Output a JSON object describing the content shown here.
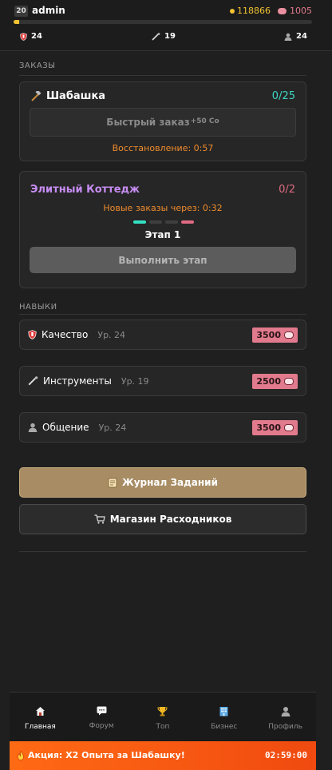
{
  "header": {
    "level": "20",
    "username": "admin",
    "coins": "118866",
    "brains": "1005",
    "xp_progress": 0.02,
    "stats": {
      "quality": "24",
      "tools": "19",
      "social": "24"
    }
  },
  "orders": {
    "section_label": "ЗАКАЗЫ",
    "basic": {
      "title": "Шабашка",
      "count": "0/25",
      "quick_label": "Быстрый заказ",
      "quick_cost": "+50 Co",
      "recovery": "Восстановление: 0:57"
    },
    "elite": {
      "title": "Элитный Коттедж",
      "count": "0/2",
      "timer": "Новые заказы через: 0:32",
      "stage": "Этап 1",
      "stage_button": "Выполнить этап"
    }
  },
  "skills": {
    "section_label": "НАВЫКИ",
    "items": [
      {
        "name": "Качество",
        "level": "Ур. 24",
        "cost": "3500",
        "icon": "shield-icon"
      },
      {
        "name": "Инструменты",
        "level": "Ур. 19",
        "cost": "2500",
        "icon": "wrench-icon"
      },
      {
        "name": "Общение",
        "level": "Ур. 24",
        "cost": "3500",
        "icon": "person-icon"
      }
    ]
  },
  "actions": {
    "journal": "Журнал Заданий",
    "shop": "Магазин Расходников"
  },
  "nav": {
    "items": [
      {
        "label": "Главная",
        "icon": "home-icon"
      },
      {
        "label": "Форум",
        "icon": "chat-icon"
      },
      {
        "label": "Топ",
        "icon": "trophy-icon"
      },
      {
        "label": "Бизнес",
        "icon": "building-icon"
      },
      {
        "label": "Профиль",
        "icon": "profile-icon"
      }
    ]
  },
  "promo": {
    "text": "Акция: X2 Опыта за Шабашку!",
    "timer": "02:59:00"
  },
  "colors": {
    "coin": "#f2c230",
    "brain": "#e07a8c",
    "accent_teal": "#3dd6c4",
    "elite_purple": "#c68cf2",
    "warning_orange": "#f08c2c",
    "journal_gold": "#a88d64",
    "promo_orange": "#ff6a14"
  }
}
